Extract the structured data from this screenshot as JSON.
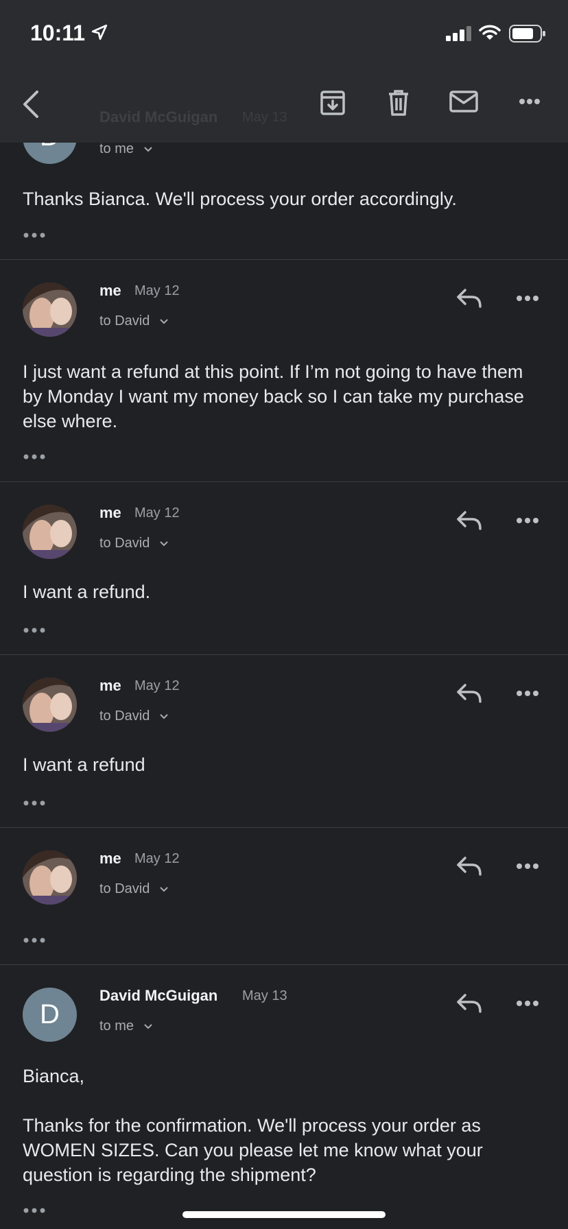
{
  "status_bar": {
    "time": "10:11"
  },
  "toolbar": {
    "back": "back-icon",
    "archive": "archive-icon",
    "delete": "delete-icon",
    "mark_unread": "mail-icon",
    "more": "more-icon",
    "ghost_sender": "David McGuigan",
    "ghost_date": "May 13"
  },
  "messages": [
    {
      "sender": "",
      "date": "",
      "to": "to me",
      "body": "Thanks Bianca. We'll process your order accordingly."
    },
    {
      "sender": "me",
      "date": "May 12",
      "to": "to David",
      "body": "I just want a refund at this point. If I’m not going to have them by Monday I want my money back so I can take my purchase else where."
    },
    {
      "sender": "me",
      "date": "May 12",
      "to": "to David",
      "body": "I want a refund."
    },
    {
      "sender": "me",
      "date": "May 12",
      "to": "to David",
      "body": "I want a refund"
    },
    {
      "sender": "me",
      "date": "May 12",
      "to": "to David",
      "body": ""
    },
    {
      "sender": "David McGuigan",
      "date": "May 13",
      "to": "to me",
      "avatar_letter": "D",
      "body_p1": "Bianca,",
      "body_p2": "Thanks for the confirmation. We'll process your order as WOMEN SIZES. Can you please let me know what your question is regarding the shipment?"
    }
  ],
  "colors": {
    "background": "#202124",
    "toolbar": "#2b2c2f",
    "avatar_d": "#6f8593"
  }
}
